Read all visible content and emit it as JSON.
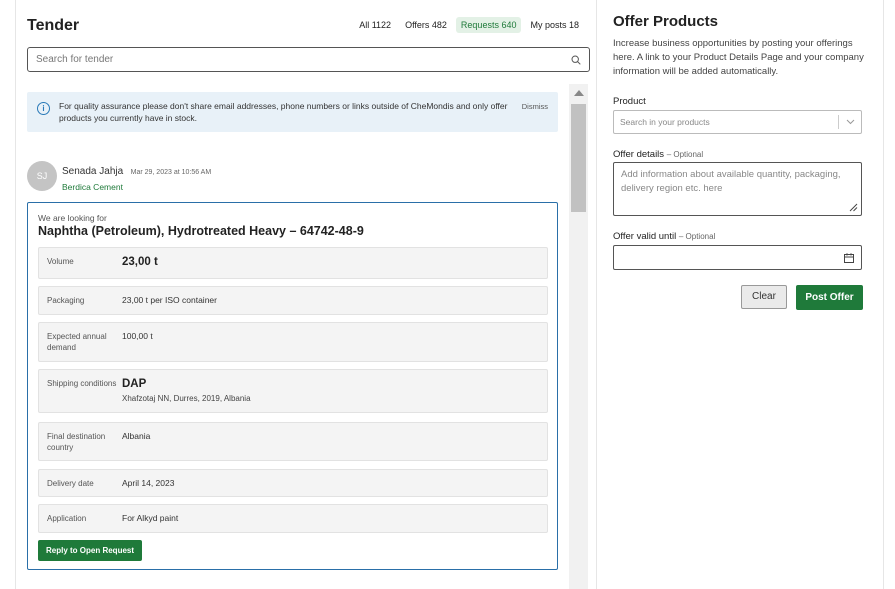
{
  "tender": {
    "title": "Tender",
    "tabs": [
      {
        "label": "All 1122",
        "active": false
      },
      {
        "label": "Offers 482",
        "active": false
      },
      {
        "label": "Requests 640",
        "active": true
      },
      {
        "label": "My posts 18",
        "active": false
      }
    ],
    "search_placeholder": "Search for tender"
  },
  "notice": {
    "text": "For quality assurance please don't share email addresses, phone numbers or links outside of CheMondis and only offer products you currently have in stock.",
    "dismiss_label": "Dismiss"
  },
  "post": {
    "author_initials": "SJ",
    "author_name": "Senada Jahja",
    "timestamp": "Mar 29, 2023 at 10:56 AM",
    "company": "Berdica Cement",
    "looking_for_label": "We are looking for",
    "product": "Naphtha (Petroleum), Hydrotreated Heavy – 64742-48-9",
    "details": [
      {
        "label": "Volume",
        "value": "23,00 t"
      },
      {
        "label": "Packaging",
        "value": "23,00 t per ISO container"
      },
      {
        "label": "Expected annual demand",
        "value": "100,00 t"
      },
      {
        "label": "Shipping conditions",
        "value": "DAP",
        "sub": "Xhafzotaj NN, Durres, 2019, Albania"
      },
      {
        "label": "Final destination country",
        "value": "Albania"
      },
      {
        "label": "Delivery date",
        "value": "April 14, 2023"
      },
      {
        "label": "Application",
        "value": "For Alkyd paint"
      }
    ],
    "reply_label": "Reply to Open Request"
  },
  "offer": {
    "title": "Offer Products",
    "description": "Increase business opportunities by posting your offerings here. A link to your Product Details Page and your company information will be added automatically.",
    "product_label": "Product",
    "product_placeholder": "Search in your products",
    "details_label": "Offer details",
    "optional_text": "– Optional",
    "details_placeholder": "Add information about available quantity, packaging, delivery region etc. here",
    "valid_until_label": "Offer valid until",
    "valid_until_value": "",
    "clear_label": "Clear",
    "post_label": "Post Offer"
  },
  "colors": {
    "accent_green": "#1f7a3a",
    "notice_blue": "#e8f1f8",
    "card_border": "#2a6fa8"
  }
}
